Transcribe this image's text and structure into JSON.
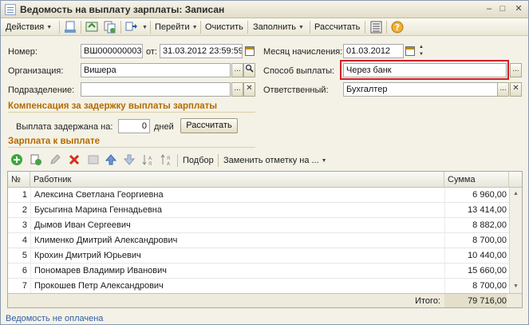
{
  "window": {
    "title": "Ведомость на выплату зарплаты: Записан",
    "minimize": "–",
    "maximize": "□",
    "close": "✕"
  },
  "toolbar": {
    "actions": "Действия",
    "goto": "Перейти",
    "clear": "Очистить",
    "fill": "Заполнить",
    "calculate": "Рассчитать"
  },
  "form": {
    "number_label": "Номер:",
    "number_value": "ВШ000000003",
    "from_label": "от:",
    "date_value": "31.03.2012 23:59:59",
    "month_label": "Месяц начисления:",
    "month_value": "01.03.2012",
    "org_label": "Организация:",
    "org_value": "Вишера",
    "payment_label": "Способ выплаты:",
    "payment_value": "Через банк",
    "dept_label": "Подразделение:",
    "dept_value": "",
    "responsible_label": "Ответственный:",
    "responsible_value": "Бухгалтер",
    "ellipsis": "...",
    "clear_x": "✕"
  },
  "compensation": {
    "title": "Компенсация за задержку выплаты зарплаты",
    "delay_label": "Выплата задержана на:",
    "delay_value": "0",
    "days_label": "дней",
    "calc_button": "Рассчитать"
  },
  "salary": {
    "title": "Зарплата к выплате",
    "select_button": "Подбор",
    "replace_mark": "Заменить отметку на ..."
  },
  "table": {
    "columns": [
      "№",
      "Работник",
      "Сумма"
    ],
    "rows": [
      {
        "n": "1",
        "worker": "Алексина Светлана Георгиевна",
        "sum": "6 960,00"
      },
      {
        "n": "2",
        "worker": "Бусыгина Марина Геннадьевна",
        "sum": "13 414,00"
      },
      {
        "n": "3",
        "worker": "Дымов  Иван Сергеевич",
        "sum": "8 882,00"
      },
      {
        "n": "4",
        "worker": "Клименко Дмитрий Александрович",
        "sum": "8 700,00"
      },
      {
        "n": "5",
        "worker": "Крохин Дмитрий Юрьевич",
        "sum": "10 440,00"
      },
      {
        "n": "6",
        "worker": "Пономарев Владимир Иванович",
        "sum": "15 660,00"
      },
      {
        "n": "7",
        "worker": "Прокошев Петр Александрович",
        "sum": "8 700,00"
      }
    ],
    "total_label": "Итого:",
    "total_value": "79 716,00"
  },
  "status": {
    "text": "Ведомость не оплачена"
  },
  "colors": {
    "accent": "#b56a00",
    "highlight": "#d0202a",
    "link": "#2f5fa8"
  }
}
